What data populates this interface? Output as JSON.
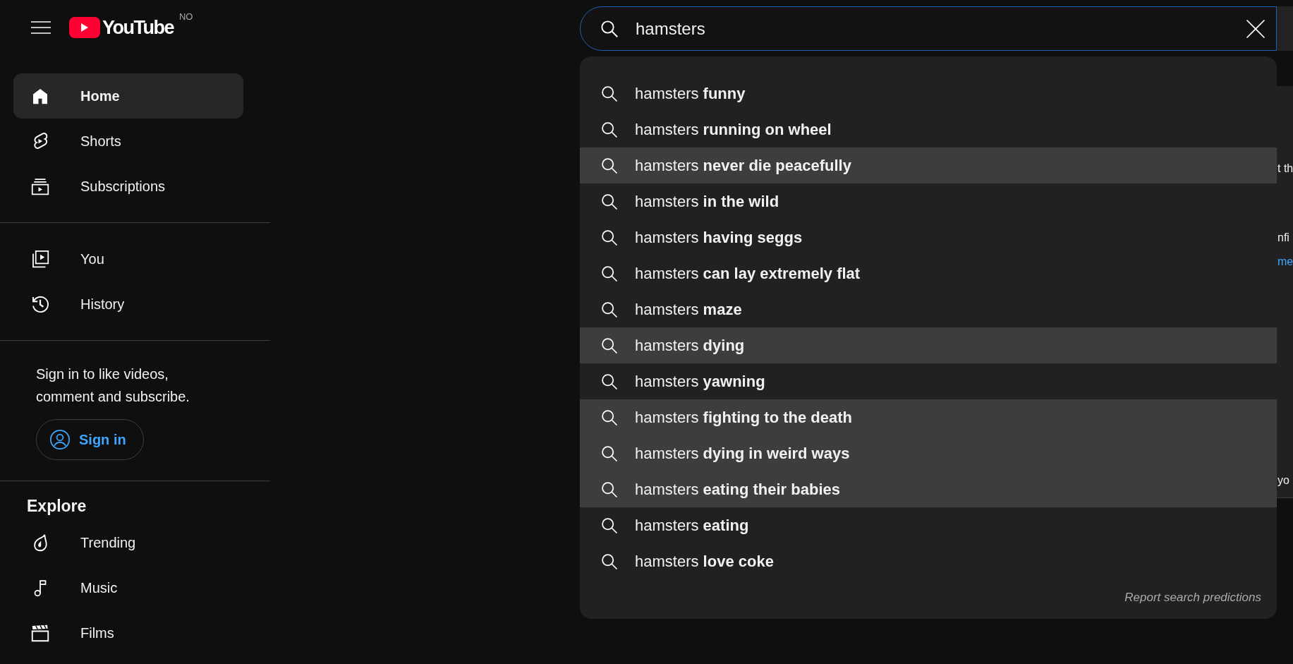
{
  "header": {
    "logo_text": "YouTube",
    "country_code": "NO"
  },
  "sidebar": {
    "sections": [
      {
        "items": [
          {
            "label": "Home",
            "kind": "home",
            "selected": true
          },
          {
            "label": "Shorts",
            "kind": "shorts",
            "selected": false
          },
          {
            "label": "Subscriptions",
            "kind": "subscriptions",
            "selected": false
          }
        ]
      },
      {
        "items": [
          {
            "label": "You",
            "kind": "you",
            "selected": false
          },
          {
            "label": "History",
            "kind": "history",
            "selected": false
          }
        ]
      }
    ],
    "sign_in_prompt": "Sign in to like videos, comment and subscribe.",
    "sign_in_button": "Sign in",
    "explore": {
      "title": "Explore",
      "items": [
        {
          "label": "Trending",
          "kind": "trending",
          "selected": false
        },
        {
          "label": "Music",
          "kind": "music",
          "selected": false
        },
        {
          "label": "Films",
          "kind": "films",
          "selected": false
        }
      ]
    }
  },
  "search": {
    "value": "hamsters"
  },
  "suggestions": [
    {
      "text": "hamsters **funny**",
      "highlighted": false
    },
    {
      "text": "hamsters **running on wheel**",
      "highlighted": false
    },
    {
      "text": "hamsters **never die peacefully**",
      "highlighted": true
    },
    {
      "text": "hamsters **in the wild**",
      "highlighted": false
    },
    {
      "text": "hamsters **having seggs**",
      "highlighted": false
    },
    {
      "text": "hamsters **can lay extremely flat**",
      "highlighted": false
    },
    {
      "text": "hamsters **maze**",
      "highlighted": false
    },
    {
      "text": "hamsters **dying**",
      "highlighted": true
    },
    {
      "text": "hamsters **yawning**",
      "highlighted": false
    },
    {
      "text": "hamsters **fighting to the death**",
      "highlighted": true
    },
    {
      "text": "hamsters **dying in weird ways**",
      "highlighted": true
    },
    {
      "text": "hamsters **eating their babies**",
      "highlighted": true
    },
    {
      "text": "hamsters **eating**",
      "highlighted": false
    },
    {
      "text": "hamsters **love coke**",
      "highlighted": false
    }
  ],
  "report_link": "Report search predictions",
  "background_panel": {
    "lines": [
      {
        "text": "t th",
        "kind": "text"
      },
      {
        "text": "nfi",
        "kind": "text"
      },
      {
        "text": "me",
        "kind": "link"
      },
      {
        "text": "yo",
        "kind": "text"
      }
    ]
  }
}
